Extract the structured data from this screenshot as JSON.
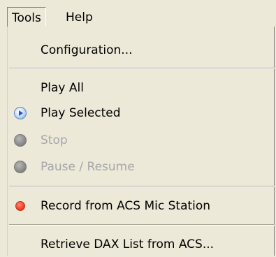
{
  "menubar": {
    "tools_label": "Tools",
    "help_label": "Help"
  },
  "tools_menu": {
    "configuration": "Configuration...",
    "play_all": "Play All",
    "play_selected": "Play Selected",
    "stop": "Stop",
    "pause_resume": "Pause / Resume",
    "record": "Record from ACS Mic Station",
    "retrieve_dax": "Retrieve DAX List from ACS..."
  },
  "icons": {
    "play_selected": "play-icon",
    "stop": "stop-icon",
    "pause_resume": "pause-icon",
    "record": "record-icon"
  },
  "states": {
    "stop_enabled": false,
    "pause_resume_enabled": false
  },
  "colors": {
    "menu_background": "#ece9d8",
    "disabled_text": "#a7a6aa",
    "record_red": "#f0452b",
    "play_blue": "#2457c6"
  }
}
